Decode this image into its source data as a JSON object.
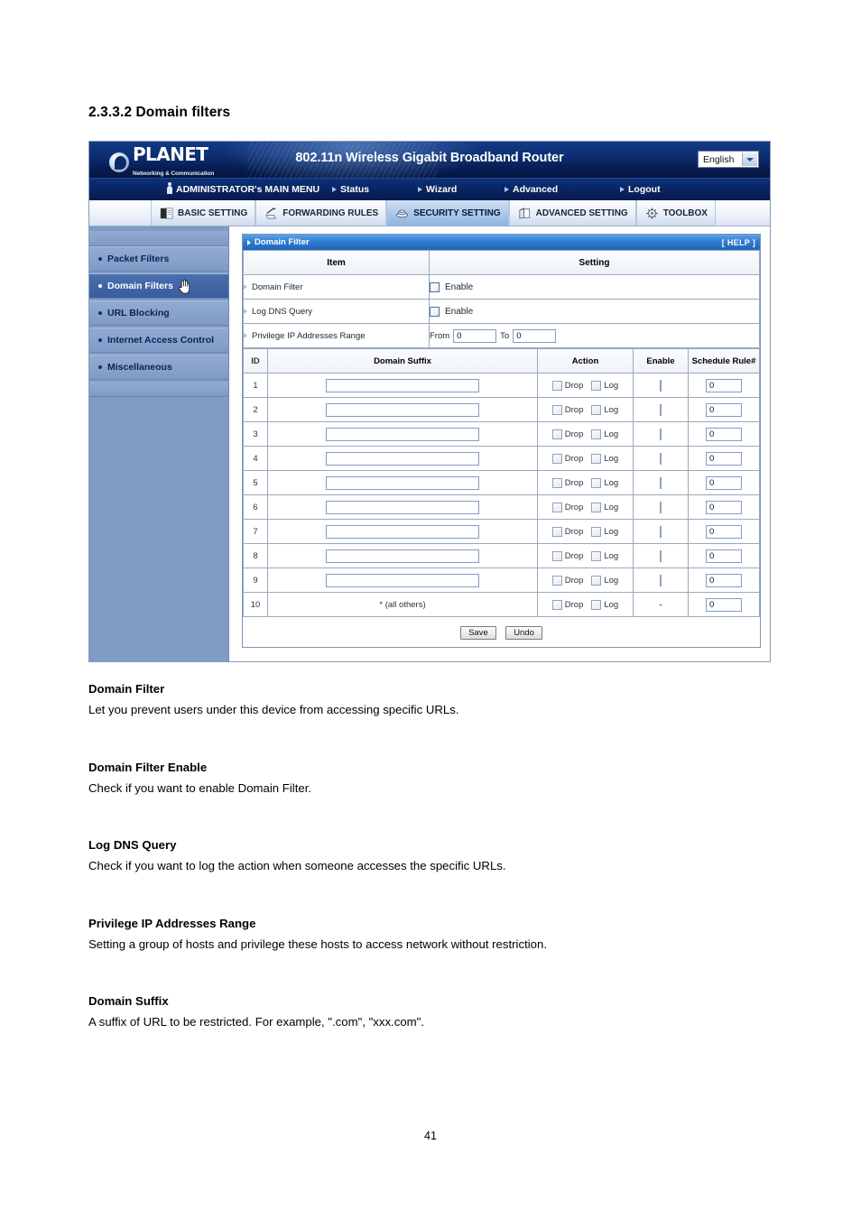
{
  "document": {
    "heading": "2.3.3.2 Domain filters",
    "page_number": "41"
  },
  "router_ui": {
    "banner": {
      "logo_name": "PLANET",
      "logo_tagline": "Networking & Communication",
      "title": "802.11n Wireless Gigabit Broadband Router",
      "language": "English"
    },
    "navbar": {
      "admin": "ADMINISTRATOR's MAIN MENU",
      "items": [
        {
          "label": "Status"
        },
        {
          "label": "Wizard"
        },
        {
          "label": "Advanced"
        },
        {
          "label": "Logout"
        }
      ]
    },
    "tabs": [
      {
        "label": "BASIC SETTING",
        "icon": "book-icon",
        "active": false
      },
      {
        "label": "FORWARDING RULES",
        "icon": "arrow-folder-icon",
        "active": false
      },
      {
        "label": "SECURITY SETTING",
        "icon": "shield-lock-icon",
        "active": true
      },
      {
        "label": "ADVANCED SETTING",
        "icon": "gear-box-icon",
        "active": false
      },
      {
        "label": "TOOLBOX",
        "icon": "toolbox-icon",
        "active": false
      }
    ],
    "sidebar": {
      "items": [
        {
          "label": "Packet Filters",
          "active": false
        },
        {
          "label": "Domain Filters",
          "active": true
        },
        {
          "label": "URL Blocking",
          "active": false
        },
        {
          "label": "Internet Access Control",
          "active": false
        },
        {
          "label": "Miscellaneous",
          "active": false
        }
      ]
    },
    "panel": {
      "title": "Domain Filter",
      "help": "[ HELP ]",
      "settings_headers": {
        "item": "Item",
        "setting": "Setting"
      },
      "settings_rows": [
        {
          "item": "Domain Filter",
          "type": "checkbox",
          "checkbox_label": "Enable",
          "checked": false
        },
        {
          "item": "Log DNS Query",
          "type": "checkbox",
          "checkbox_label": "Enable",
          "checked": false
        },
        {
          "item": "Privilege IP Addresses Range",
          "type": "range",
          "from_label": "From",
          "from_value": "0",
          "to_label": "To",
          "to_value": "0"
        }
      ],
      "rules_headers": [
        "ID",
        "Domain Suffix",
        "Action",
        "Enable",
        "Schedule Rule#"
      ],
      "action_labels": {
        "drop": "Drop",
        "log": "Log"
      },
      "rules": [
        {
          "id": "1",
          "suffix": "",
          "editable": true,
          "drop": false,
          "log": false,
          "enable": false,
          "enable_dash": false,
          "schedule": "0"
        },
        {
          "id": "2",
          "suffix": "",
          "editable": true,
          "drop": false,
          "log": false,
          "enable": false,
          "enable_dash": false,
          "schedule": "0"
        },
        {
          "id": "3",
          "suffix": "",
          "editable": true,
          "drop": false,
          "log": false,
          "enable": false,
          "enable_dash": false,
          "schedule": "0"
        },
        {
          "id": "4",
          "suffix": "",
          "editable": true,
          "drop": false,
          "log": false,
          "enable": false,
          "enable_dash": false,
          "schedule": "0"
        },
        {
          "id": "5",
          "suffix": "",
          "editable": true,
          "drop": false,
          "log": false,
          "enable": false,
          "enable_dash": false,
          "schedule": "0"
        },
        {
          "id": "6",
          "suffix": "",
          "editable": true,
          "drop": false,
          "log": false,
          "enable": false,
          "enable_dash": false,
          "schedule": "0"
        },
        {
          "id": "7",
          "suffix": "",
          "editable": true,
          "drop": false,
          "log": false,
          "enable": false,
          "enable_dash": false,
          "schedule": "0"
        },
        {
          "id": "8",
          "suffix": "",
          "editable": true,
          "drop": false,
          "log": false,
          "enable": false,
          "enable_dash": false,
          "schedule": "0"
        },
        {
          "id": "9",
          "suffix": "",
          "editable": true,
          "drop": false,
          "log": false,
          "enable": false,
          "enable_dash": false,
          "schedule": "0"
        },
        {
          "id": "10",
          "suffix": "* (all others)",
          "editable": false,
          "drop": false,
          "log": false,
          "enable": false,
          "enable_dash": true,
          "enable_dash_text": "-",
          "schedule": "0"
        }
      ],
      "buttons": {
        "save": "Save",
        "undo": "Undo"
      }
    }
  },
  "descriptions": [
    {
      "heading": "Domain Filter",
      "body": "Let you prevent users under this device from accessing specific URLs."
    },
    {
      "heading": "Domain Filter Enable",
      "body": "Check if you want to enable Domain Filter."
    },
    {
      "heading": "Log DNS Query",
      "body": "Check if you want to log the action when someone accesses the specific URLs."
    },
    {
      "heading": "Privilege IP Addresses Range",
      "body": "Setting a group of hosts and privilege these hosts to access network without restriction."
    },
    {
      "heading": "Domain Suffix",
      "body": "A suffix of URL to be restricted. For example, \".com\", \"xxx.com\"."
    }
  ],
  "colors": {
    "banner_dark": "#07215c",
    "nav_blue": "#0a2664",
    "sidebar_blue": "#7f9bc6",
    "sidebar_active": "#3a5d9c",
    "panel_header_blue": "#2d7ad0",
    "tab_active": "#8fb4e0"
  }
}
